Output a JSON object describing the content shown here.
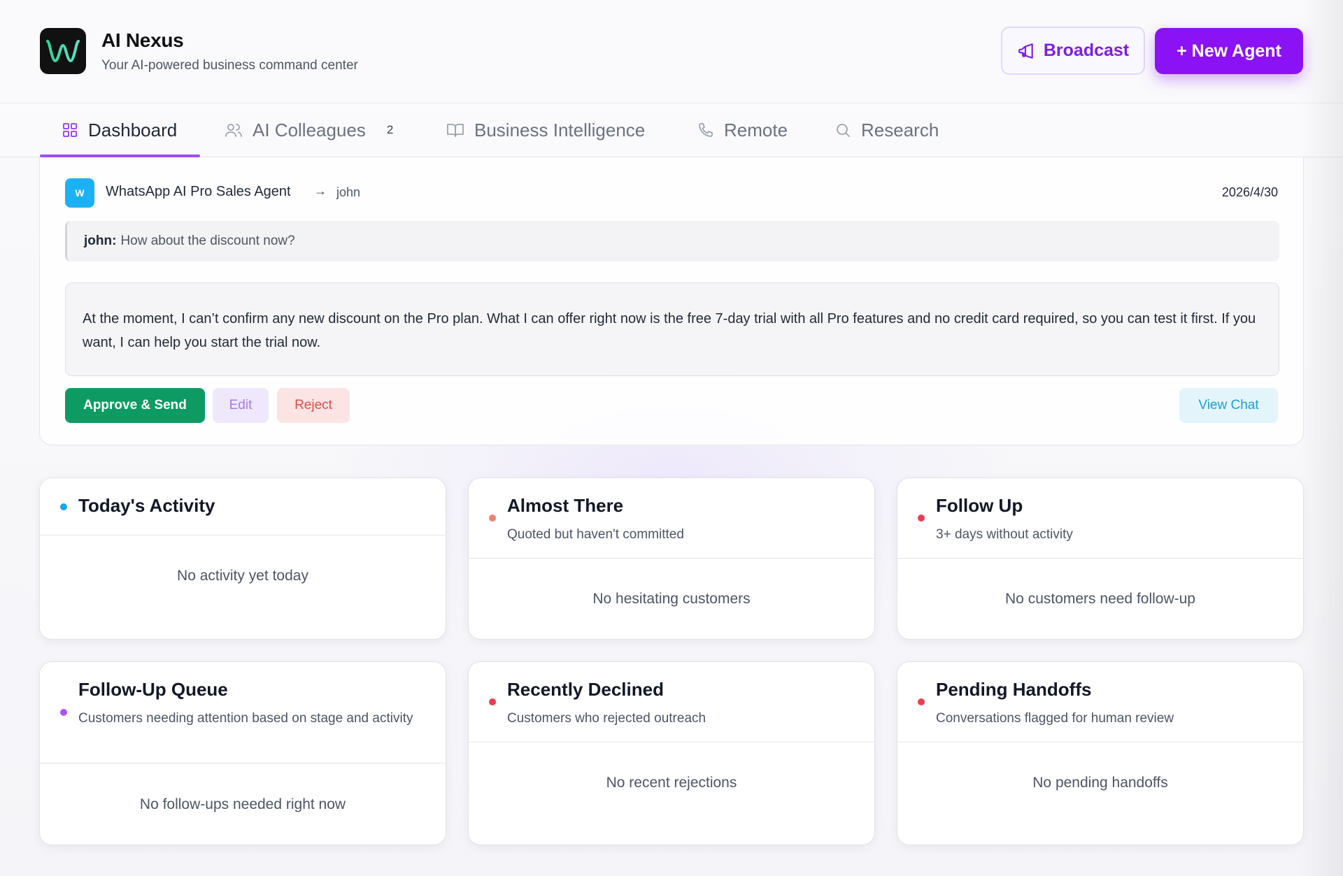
{
  "header": {
    "app_title": "AI Nexus",
    "app_subtitle": "Your AI-powered business command center",
    "logo_icon": "wave-w-logo",
    "broadcast_label": "Broadcast",
    "new_agent_label": "+ New Agent"
  },
  "tabs": [
    {
      "label": "Dashboard",
      "icon": "grid-icon",
      "active": true
    },
    {
      "label": "AI Colleagues",
      "icon": "users-icon",
      "badge": "2"
    },
    {
      "label": "Business Intelligence",
      "icon": "book-icon"
    },
    {
      "label": "Remote",
      "icon": "phone-icon"
    },
    {
      "label": "Research",
      "icon": "search-icon"
    }
  ],
  "approval": {
    "avatar_letter": "W",
    "agent_name": "WhatsApp AI Pro Sales Agent",
    "arrow": "→",
    "recipient": "john",
    "date": "2026/4/30",
    "incoming_sender": "john:",
    "incoming_text": "How about the discount now?",
    "draft_reply": "At the moment, I can’t confirm any new discount on the Pro plan. What I can offer right now is the free 7-day trial with all Pro features and no credit card required, so you can test it first. If you want, I can help you start the trial now.",
    "approve_label": "Approve & Send",
    "edit_label": "Edit",
    "reject_label": "Reject",
    "view_chat_label": "View Chat"
  },
  "cards": [
    {
      "title": "Today's Activity",
      "subtitle": "",
      "empty": "No activity yet today",
      "dot_color": "#1aa7ec"
    },
    {
      "title": "Almost There",
      "subtitle": "Quoted but haven't committed",
      "empty": "No hesitating customers",
      "dot_color": "#f0806a"
    },
    {
      "title": "Follow Up",
      "subtitle": "3+ days without activity",
      "empty": "No customers need follow-up",
      "dot_color": "#ee3b54"
    },
    {
      "title": "Follow-Up Queue",
      "subtitle": "Customers needing attention based on stage and activity",
      "empty": "No follow-ups needed right now",
      "dot_color": "#a855f7"
    },
    {
      "title": "Recently Declined",
      "subtitle": "Customers who rejected outreach",
      "empty": "No recent rejections",
      "dot_color": "#ee3b54"
    },
    {
      "title": "Pending Handoffs",
      "subtitle": "Conversations flagged for human review",
      "empty": "No pending handoffs",
      "dot_color": "#ee3b54"
    }
  ],
  "colors": {
    "accent": "#8a12f5",
    "approve": "#0d9b63",
    "reject": "#e04b4b",
    "info": "#1b9fd6"
  }
}
